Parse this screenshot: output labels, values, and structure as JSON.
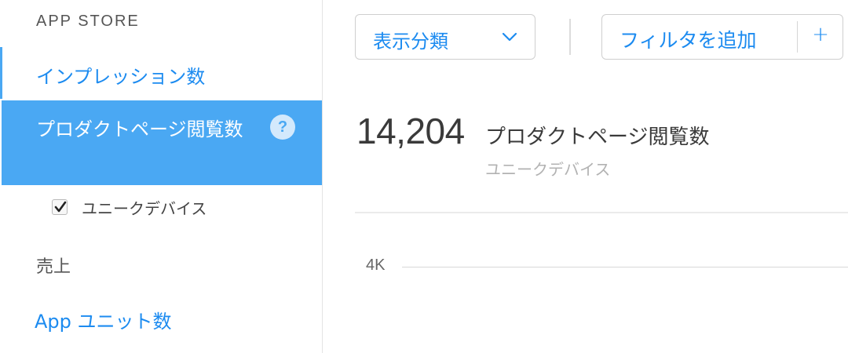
{
  "sidebar": {
    "section_title": "APP STORE",
    "items": [
      {
        "label": "インプレッション数"
      },
      {
        "label": "プロダクトページ閲覧数",
        "help": "?"
      },
      {
        "label": "売上"
      },
      {
        "label": "App ユニット数"
      }
    ],
    "sub_option": {
      "label": "ユニークデバイス",
      "checked": true
    }
  },
  "toolbar": {
    "dropdown_label": "表示分類",
    "filter_label": "フィルタを追加",
    "plus_label": "+"
  },
  "metric": {
    "value": "14,204",
    "title": "プロダクトページ閲覧数",
    "subtitle": "ユニークデバイス"
  },
  "chart_data": {
    "type": "line",
    "y_ticks": [
      "4K"
    ],
    "series": []
  },
  "colors": {
    "accent": "#1c8bf0",
    "selected_bg": "#4aa8f3"
  }
}
